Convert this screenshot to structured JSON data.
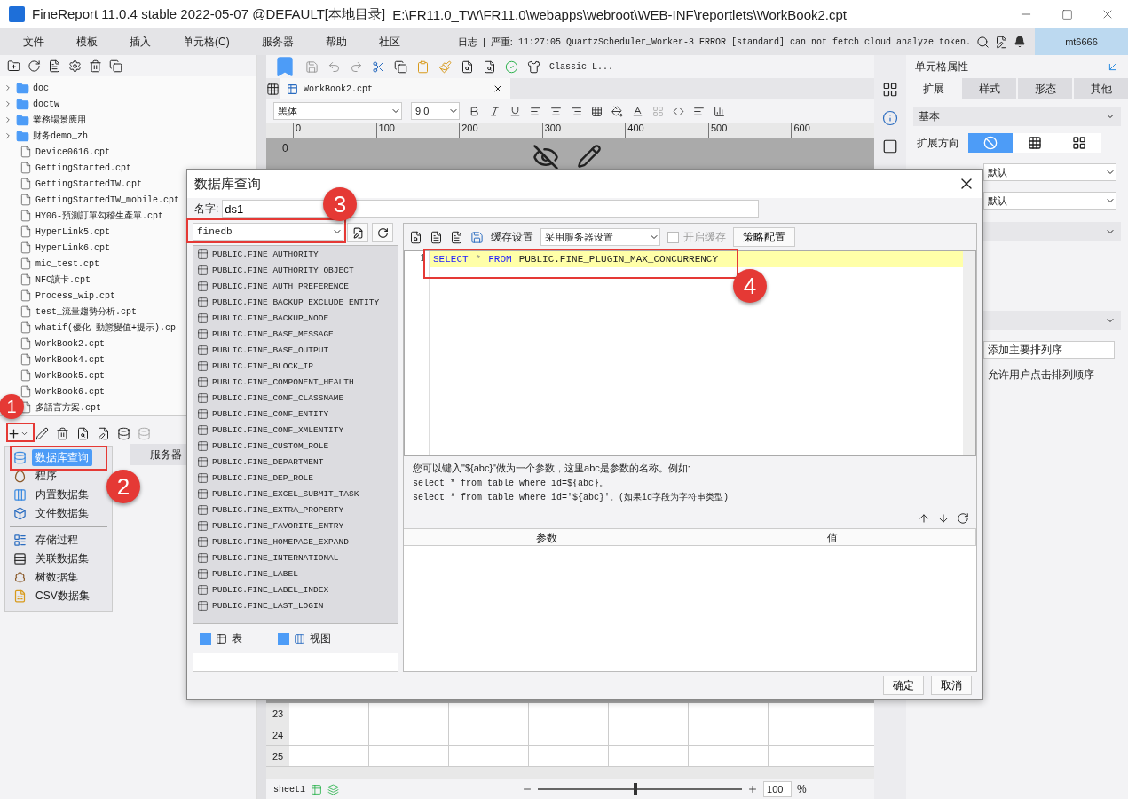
{
  "window": {
    "title": "FineReport 11.0.4 stable 2022-05-07 @DEFAULT[本地目录]",
    "path": "E:\\FR11.0_TW\\FR11.0\\webapps\\webroot\\WEB-INF\\reportlets\\WorkBook2.cpt"
  },
  "menu": [
    "文件",
    "模板",
    "插入",
    "单元格(C)",
    "服务器",
    "帮助",
    "社区"
  ],
  "log": {
    "label": "日志",
    "separator": "|",
    "level": "严重:",
    "message": "11:27:05 QuartzScheduler_Worker-3 ERROR [standard] can not fetch cloud analyze token."
  },
  "user": "mt6666",
  "file_tree": [
    {
      "label": "doc",
      "kind": "folder",
      "expanded": false
    },
    {
      "label": "doctw",
      "kind": "folder",
      "expanded": false
    },
    {
      "label": "業務場景應用",
      "kind": "folder",
      "expanded": false
    },
    {
      "label": "财务demo_zh",
      "kind": "folder",
      "expanded": false
    },
    {
      "label": "Device0616.cpt",
      "kind": "file"
    },
    {
      "label": "GettingStarted.cpt",
      "kind": "file"
    },
    {
      "label": "GettingStartedTW.cpt",
      "kind": "file"
    },
    {
      "label": "GettingStartedTW_mobile.cpt",
      "kind": "file"
    },
    {
      "label": "HY06-預測訂單勾稽生產單.cpt",
      "kind": "file"
    },
    {
      "label": "HyperLink5.cpt",
      "kind": "file"
    },
    {
      "label": "HyperLink6.cpt",
      "kind": "file"
    },
    {
      "label": "mic_test.cpt",
      "kind": "file"
    },
    {
      "label": "NFC讀卡.cpt",
      "kind": "file"
    },
    {
      "label": "Process_wip.cpt",
      "kind": "file"
    },
    {
      "label": "test_流量趨勢分析.cpt",
      "kind": "file"
    },
    {
      "label": "whatif(優化-動態變值+提示).cp",
      "kind": "file"
    },
    {
      "label": "WorkBook2.cpt",
      "kind": "file"
    },
    {
      "label": "WorkBook4.cpt",
      "kind": "file"
    },
    {
      "label": "WorkBook5.cpt",
      "kind": "file"
    },
    {
      "label": "WorkBook6.cpt",
      "kind": "file"
    },
    {
      "label": "多語言方案.cpt",
      "kind": "file"
    }
  ],
  "dataset_panel": {
    "tab": "服务器"
  },
  "add_menu": [
    [
      {
        "label": "数据库查询",
        "kind": "db",
        "selected": true
      },
      {
        "label": "程序",
        "kind": "program",
        "selected": false
      },
      {
        "label": "内置数据集",
        "kind": "builtin",
        "selected": false
      },
      {
        "label": "文件数据集",
        "kind": "file",
        "selected": false
      }
    ],
    [
      {
        "label": "存储过程",
        "kind": "procedure",
        "selected": false
      },
      {
        "label": "关联数据集",
        "kind": "relation",
        "selected": false
      },
      {
        "label": "树数据集",
        "kind": "tree",
        "selected": false
      },
      {
        "label": "CSV数据集",
        "kind": "csv",
        "selected": false
      }
    ]
  ],
  "editor": {
    "theme": "Classic L...",
    "tab": "WorkBook2.cpt",
    "font": "黑体",
    "size": "9.0",
    "ruler": [
      "0",
      "100",
      "200",
      "300",
      "400",
      "500",
      "600"
    ],
    "vruler": "0",
    "rows": [
      "23",
      "24",
      "25"
    ],
    "sheet": "sheet1",
    "zoom_slider": {
      "level": 0.48
    },
    "zoom": "100",
    "zoom_unit": "%"
  },
  "properties": {
    "title": "单元格属性",
    "tabs": [
      {
        "label": "扩展",
        "selected": true
      },
      {
        "label": "样式",
        "selected": false
      },
      {
        "label": "形态",
        "selected": false
      },
      {
        "label": "其他",
        "selected": false
      }
    ],
    "section": "基本",
    "expand_label": "扩展方向",
    "expand_options": [
      {
        "kind": "none",
        "selected": true
      },
      {
        "kind": "vertical",
        "selected": false
      },
      {
        "kind": "horizontal",
        "selected": false
      }
    ],
    "selects": [
      "默认",
      "默认"
    ],
    "sort_field": "添加主要排列序",
    "checkbox_label": "允许用户点击排列顺序"
  },
  "dialog": {
    "title": "数据库查询",
    "name_label": "名字:",
    "name_value": "ds1",
    "database": "finedb",
    "tables": [
      "PUBLIC.FINE_AUTHORITY",
      "PUBLIC.FINE_AUTHORITY_OBJECT",
      "PUBLIC.FINE_AUTH_PREFERENCE",
      "PUBLIC.FINE_BACKUP_EXCLUDE_ENTITY",
      "PUBLIC.FINE_BACKUP_NODE",
      "PUBLIC.FINE_BASE_MESSAGE",
      "PUBLIC.FINE_BASE_OUTPUT",
      "PUBLIC.FINE_BLOCK_IP",
      "PUBLIC.FINE_COMPONENT_HEALTH",
      "PUBLIC.FINE_CONF_CLASSNAME",
      "PUBLIC.FINE_CONF_ENTITY",
      "PUBLIC.FINE_CONF_XMLENTITY",
      "PUBLIC.FINE_CUSTOM_ROLE",
      "PUBLIC.FINE_DEPARTMENT",
      "PUBLIC.FINE_DEP_ROLE",
      "PUBLIC.FINE_EXCEL_SUBMIT_TASK",
      "PUBLIC.FINE_EXTRA_PROPERTY",
      "PUBLIC.FINE_FAVORITE_ENTRY",
      "PUBLIC.FINE_HOMEPAGE_EXPAND",
      "PUBLIC.FINE_INTERNATIONAL",
      "PUBLIC.FINE_LABEL",
      "PUBLIC.FINE_LABEL_INDEX",
      "PUBLIC.FINE_LAST_LOGIN"
    ],
    "filters": [
      {
        "label": "表",
        "kind": "table",
        "checked": true
      },
      {
        "label": "视图",
        "kind": "view",
        "checked": true
      }
    ],
    "cache_label": "缓存设置",
    "cache_select": "采用服务器设置",
    "cache_toggle": {
      "label": "开启缓存",
      "checked": false,
      "disabled": true
    },
    "policy_button": "策略配置",
    "line_number": "1",
    "sql": [
      {
        "text": "SELECT",
        "kind": "keyword"
      },
      {
        "text": "*",
        "kind": "operator"
      },
      {
        "text": "FROM",
        "kind": "keyword"
      },
      {
        "text": "PUBLIC.FINE_PLUGIN_MAX_CONCURRENCY",
        "kind": "name"
      }
    ],
    "hint": [
      "您可以键入\"${abc}\"做为一个参数，这里abc是参数的名称。例如:",
      "select * from table where id=${abc}。",
      "select * from table where id='${abc}'。(如果id字段为字符串类型)"
    ],
    "param_columns": [
      "参数",
      "值"
    ],
    "buttons": [
      "确定",
      "取消"
    ]
  },
  "annotations": [
    {
      "number": "1"
    },
    {
      "number": "2"
    },
    {
      "number": "3"
    },
    {
      "number": "4"
    }
  ]
}
